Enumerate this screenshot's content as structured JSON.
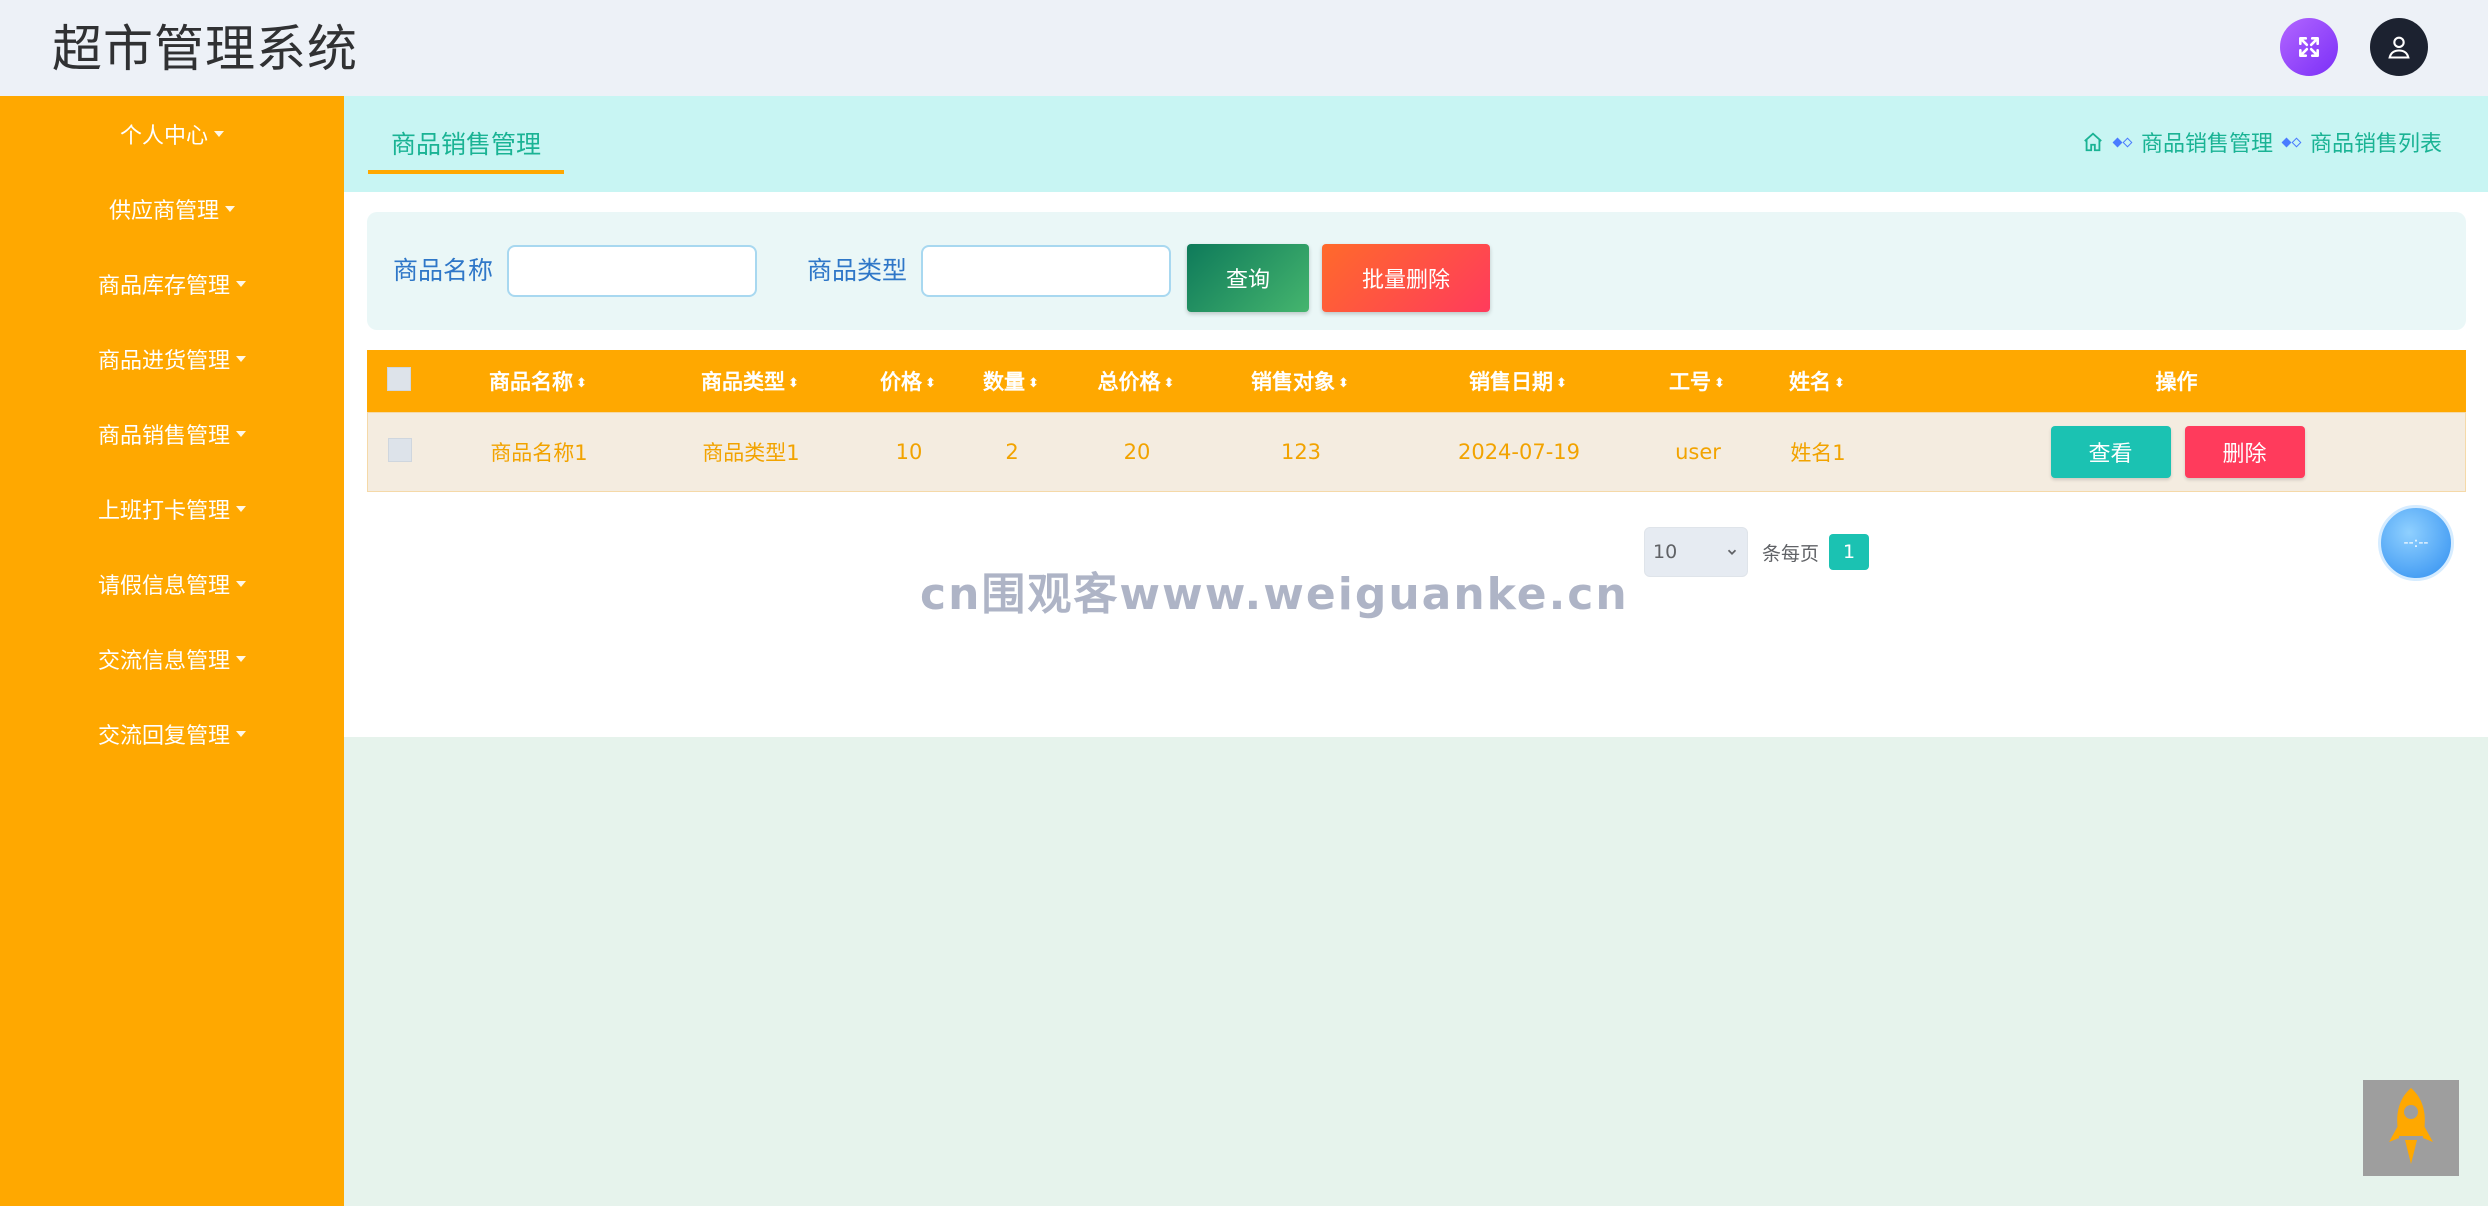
{
  "app": {
    "title": "超市管理系统"
  },
  "header": {
    "fullscreen_icon": "expand-arrows-icon",
    "user_icon": "user-icon"
  },
  "sidebar": {
    "items": [
      {
        "label": "个人中心"
      },
      {
        "label": "供应商管理"
      },
      {
        "label": "商品库存管理"
      },
      {
        "label": "商品进货管理"
      },
      {
        "label": "商品销售管理"
      },
      {
        "label": "上班打卡管理"
      },
      {
        "label": "请假信息管理"
      },
      {
        "label": "交流信息管理"
      },
      {
        "label": "交流回复管理"
      }
    ]
  },
  "tab": {
    "active_label": "商品销售管理"
  },
  "breadcrumb": {
    "level1": "商品销售管理",
    "level2": "商品销售列表"
  },
  "search": {
    "name_label": "商品名称",
    "name_value": "",
    "type_label": "商品类型",
    "type_value": "",
    "query_label": "查询",
    "batch_delete_label": "批量删除"
  },
  "table": {
    "headers": {
      "name": "商品名称",
      "type": "商品类型",
      "price": "价格",
      "qty": "数量",
      "total": "总价格",
      "target": "销售对象",
      "date": "销售日期",
      "worker_id": "工号",
      "person_name": "姓名",
      "actions": "操作"
    },
    "rows": [
      {
        "name": "商品名称1",
        "type": "商品类型1",
        "price": "10",
        "qty": "2",
        "total": "20",
        "target": "123",
        "date": "2024-07-19",
        "worker_id": "user",
        "person_name": "姓名1",
        "view_label": "查看",
        "delete_label": "删除"
      }
    ]
  },
  "pagination": {
    "page_size": "10",
    "per_page_text": "条每页",
    "current_page": "1"
  },
  "watermark": "cn围观客www.weiguanke.cn",
  "clock_text": "--:--",
  "colors": {
    "accent": "#ffa800",
    "teal": "#1bc2b2",
    "danger": "#ff3b5c"
  }
}
